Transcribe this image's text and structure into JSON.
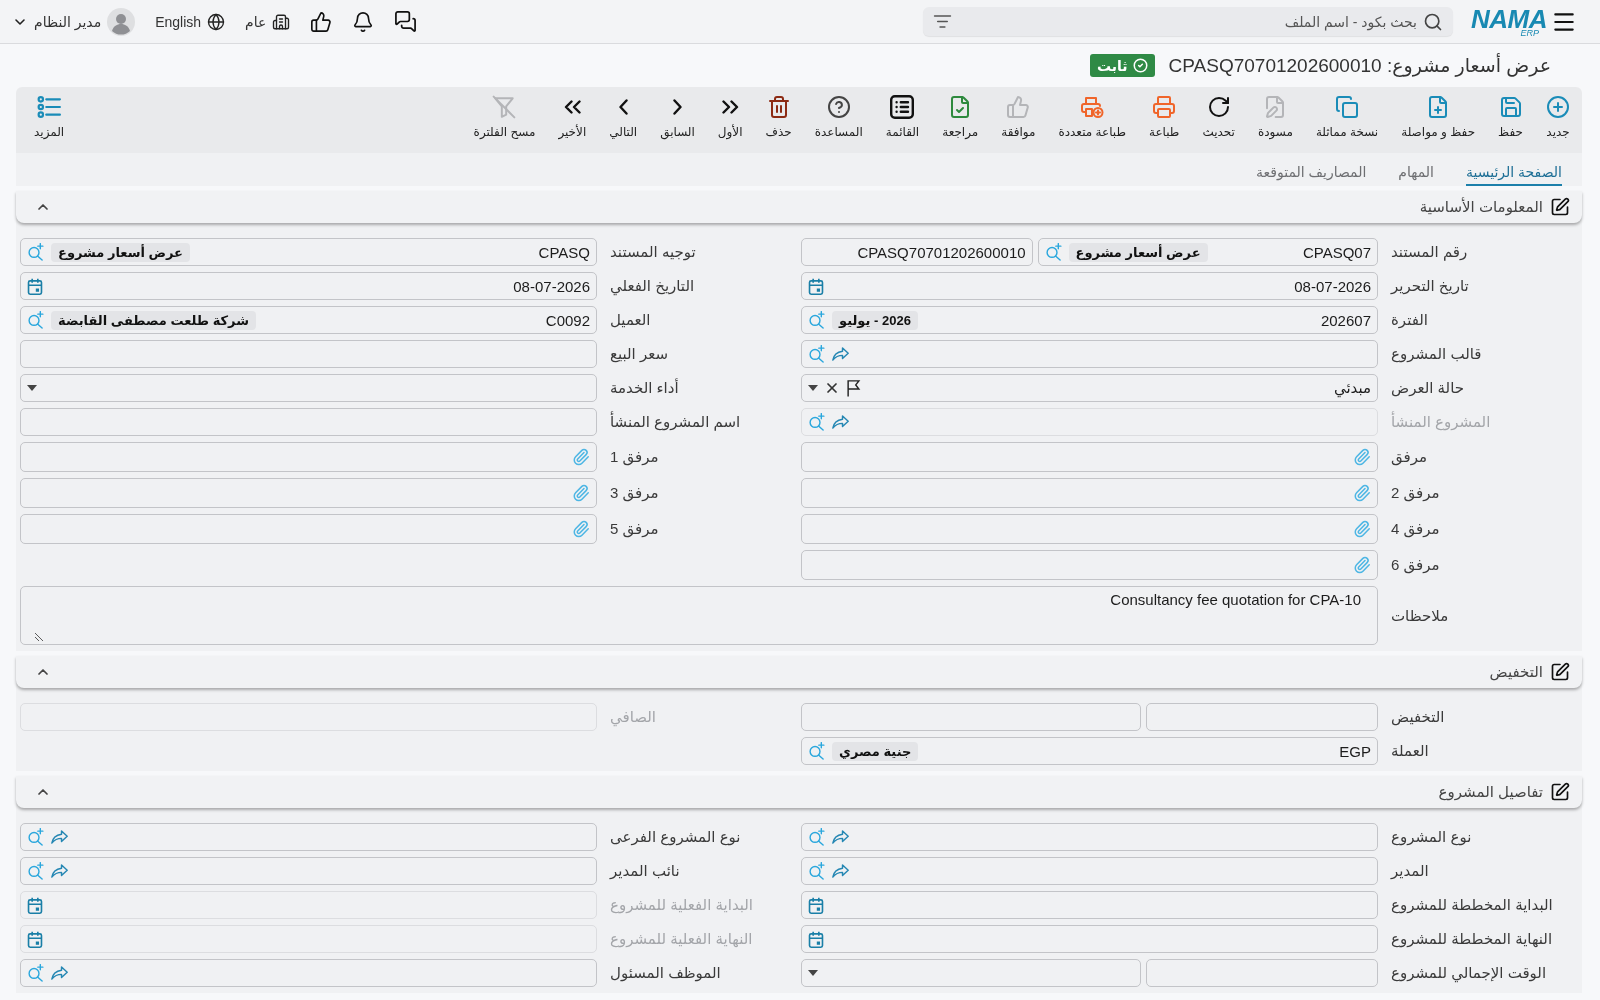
{
  "topbar": {
    "logo": {
      "name": "NAMA",
      "suffix": "ERP"
    },
    "search": {
      "placeholder": "بحث بكود - اسم الملف"
    },
    "branch": "عام",
    "language": "English",
    "user": "مدير النظام"
  },
  "page_title": {
    "text": "عرض أسعار مشروع: CPASQ70701202600010",
    "status": "ثابت"
  },
  "toolbar": {
    "actions": [
      {
        "kind": "new",
        "label": "جديد",
        "disabled": false
      },
      {
        "kind": "save",
        "label": "حفظ",
        "disabled": false
      },
      {
        "kind": "savenext",
        "label": "حفظ و مواصلة",
        "disabled": false
      },
      {
        "kind": "duplicate",
        "label": "نسخة مماثلة",
        "disabled": false
      },
      {
        "kind": "draft",
        "label": "مسودة",
        "disabled": true
      },
      {
        "kind": "refresh",
        "label": "تحديث",
        "disabled": false
      },
      {
        "kind": "print",
        "label": "طباعة",
        "disabled": false
      },
      {
        "kind": "multiprint",
        "label": "طباعة متعددة",
        "disabled": false
      },
      {
        "kind": "approve",
        "label": "موافقة",
        "disabled": true
      },
      {
        "kind": "review",
        "label": "مراجعة",
        "disabled": false
      },
      {
        "kind": "list",
        "label": "القائمة",
        "disabled": false
      },
      {
        "kind": "help",
        "label": "المساعدة",
        "disabled": false
      },
      {
        "kind": "delete",
        "label": "حذف",
        "disabled": false
      },
      {
        "kind": "first",
        "label": "الأول",
        "disabled": false
      },
      {
        "kind": "previous",
        "label": "السابق",
        "disabled": false
      },
      {
        "kind": "next",
        "label": "التالي",
        "disabled": false
      },
      {
        "kind": "last",
        "label": "الأخير",
        "disabled": false
      },
      {
        "kind": "unfilter",
        "label": "مسح الفلترة",
        "disabled": true
      }
    ],
    "more": "المزيد"
  },
  "tabs": [
    {
      "label": "الصفحة الرئيسية",
      "selected": true
    },
    {
      "label": "المهام",
      "selected": false
    },
    {
      "label": "المصاريف المتوقعة",
      "selected": false
    }
  ],
  "sections": [
    {
      "title": "المعلومات الأساسية",
      "expanded": true,
      "rows": [
        [
          {
            "label": "رقم المستند",
            "disabled": false,
            "inputs": [
              {
                "kind": "lookup",
                "value": "CPASQ07",
                "tag": "عرض أسعار مشروع"
              },
              {
                "kind": "text",
                "value": "CPASQ70701202600010"
              }
            ]
          },
          {
            "label": "توجيه المستند",
            "disabled": false,
            "inputs": [
              {
                "kind": "lookup",
                "value": "CPASQ",
                "tag": "عرض أسعار مشروع"
              }
            ]
          }
        ],
        [
          {
            "label": "تاريخ التحرير",
            "disabled": false,
            "inputs": [
              {
                "kind": "date",
                "value": "08-07-2026"
              }
            ]
          },
          {
            "label": "التاريخ الفعلي",
            "disabled": false,
            "inputs": [
              {
                "kind": "date",
                "value": "08-07-2026"
              }
            ]
          }
        ],
        [
          {
            "label": "الفترة",
            "disabled": false,
            "inputs": [
              {
                "kind": "lookup",
                "value": "202607",
                "tag": "2026 - يوليو"
              }
            ]
          },
          {
            "label": "العميل",
            "disabled": false,
            "inputs": [
              {
                "kind": "lookup",
                "value": "C0092",
                "tag": "شركة طلعت مصطفى القابضة"
              }
            ]
          }
        ],
        [
          {
            "label": "قالب المشروع",
            "disabled": false,
            "inputs": [
              {
                "kind": "link"
              }
            ]
          },
          {
            "label": "سعر البيع",
            "disabled": false,
            "inputs": [
              {
                "kind": "text"
              }
            ]
          }
        ],
        [
          {
            "label": "حالة العرض",
            "disabled": false,
            "inputs": [
              {
                "kind": "status",
                "value": "مبدئي"
              }
            ]
          },
          {
            "label": "أداء الخدمة",
            "disabled": false,
            "inputs": [
              {
                "kind": "select"
              }
            ]
          }
        ],
        [
          {
            "label": "المشروع المنشأ",
            "disabled": true,
            "inputs": [
              {
                "kind": "link"
              }
            ]
          },
          {
            "label": "اسم المشروع المنشأ",
            "disabled": false,
            "inputs": [
              {
                "kind": "text"
              }
            ]
          }
        ],
        [
          {
            "label": "مرفق",
            "disabled": false,
            "inputs": [
              {
                "kind": "attachment"
              }
            ]
          },
          {
            "label": "مرفق 1",
            "disabled": false,
            "inputs": [
              {
                "kind": "attachment"
              }
            ]
          }
        ],
        [
          {
            "label": "مرفق 2",
            "disabled": false,
            "inputs": [
              {
                "kind": "attachment"
              }
            ]
          },
          {
            "label": "مرفق 3",
            "disabled": false,
            "inputs": [
              {
                "kind": "attachment"
              }
            ]
          }
        ],
        [
          {
            "label": "مرفق 4",
            "disabled": false,
            "inputs": [
              {
                "kind": "attachment"
              }
            ]
          },
          {
            "label": "مرفق 5",
            "disabled": false,
            "inputs": [
              {
                "kind": "attachment"
              }
            ]
          }
        ],
        [
          {
            "label": "مرفق 6",
            "disabled": false,
            "inputs": [
              {
                "kind": "attachment"
              }
            ]
          }
        ],
        [
          {
            "label": "ملاحظات",
            "disabled": false,
            "inputs": [
              {
                "kind": "notes",
                "value": "Consultancy fee quotation for CPA-10"
              }
            ]
          }
        ]
      ]
    },
    {
      "title": "التخفيض",
      "expanded": true,
      "rows": [
        [
          {
            "label": "التخفيض",
            "disabled": false,
            "inputs": [
              {
                "kind": "text"
              },
              {
                "kind": "text"
              }
            ]
          },
          {
            "label": "الصافي",
            "disabled": true,
            "inputs": [
              {
                "kind": "text"
              }
            ]
          }
        ],
        [
          {
            "label": "العملة",
            "disabled": false,
            "inputs": [
              {
                "kind": "lookup",
                "value": "EGP",
                "tag": "جنية مصري"
              }
            ]
          }
        ]
      ]
    },
    {
      "title": "تفاصيل المشروع",
      "expanded": true,
      "rows": [
        [
          {
            "label": "نوع المشروع",
            "disabled": false,
            "inputs": [
              {
                "kind": "link"
              }
            ]
          },
          {
            "label": "نوع المشروع الفرعى",
            "disabled": false,
            "inputs": [
              {
                "kind": "link"
              }
            ]
          }
        ],
        [
          {
            "label": "المدير",
            "disabled": false,
            "inputs": [
              {
                "kind": "link"
              }
            ]
          },
          {
            "label": "نائب المدير",
            "disabled": false,
            "inputs": [
              {
                "kind": "link"
              }
            ]
          }
        ],
        [
          {
            "label": "البداية المخططة للمشروع",
            "disabled": false,
            "inputs": [
              {
                "kind": "date"
              }
            ]
          },
          {
            "label": "البداية الفعلية للمشروع",
            "disabled": true,
            "inputs": [
              {
                "kind": "date"
              }
            ]
          }
        ],
        [
          {
            "label": "النهاية المخططة للمشروع",
            "disabled": false,
            "inputs": [
              {
                "kind": "date"
              }
            ]
          },
          {
            "label": "النهاية الفعلية للمشروع",
            "disabled": true,
            "inputs": [
              {
                "kind": "date"
              }
            ]
          }
        ],
        [
          {
            "label": "الوقت الإجمالي للمشروع",
            "disabled": false,
            "inputs": [
              {
                "kind": "text"
              },
              {
                "kind": "select"
              }
            ]
          },
          {
            "label": "الموظف المسئول",
            "disabled": false,
            "inputs": [
              {
                "kind": "link"
              }
            ]
          }
        ]
      ]
    }
  ]
}
